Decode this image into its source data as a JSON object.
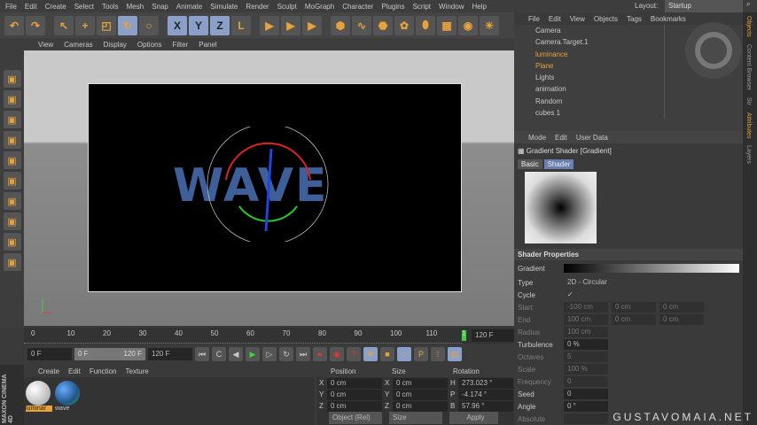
{
  "menu": [
    "File",
    "Edit",
    "Create",
    "Select",
    "Tools",
    "Mesh",
    "Snap",
    "Animate",
    "Simulate",
    "Render",
    "Sculpt",
    "MoGraph",
    "Character",
    "Plugins",
    "Script",
    "Window",
    "Help"
  ],
  "toolbar_icons": [
    "undo-icon",
    "redo-icon",
    "live-select-icon",
    "move-icon",
    "scale-icon",
    "rotate-icon",
    "recent-tool-icon",
    "x-axis-icon",
    "y-axis-icon",
    "z-axis-icon",
    "coordinate-system-icon",
    "render-view-icon",
    "render-picture-viewer-icon",
    "render-settings-icon",
    "cube-icon",
    "spline-icon",
    "nurbs-icon",
    "array-icon",
    "deformer-icon",
    "floor-icon",
    "camera-icon",
    "light-icon"
  ],
  "toolbar_labels": {
    "x": "X",
    "y": "Y",
    "z": "Z"
  },
  "viewport_menu": [
    "View",
    "Cameras",
    "Display",
    "Options",
    "Filter",
    "Panel"
  ],
  "viewport_text": "WAVE",
  "layout": {
    "label": "Layout:",
    "value": "Startup"
  },
  "object_manager": {
    "menu": [
      "File",
      "Edit",
      "View",
      "Objects",
      "Tags",
      "Bookmarks"
    ],
    "objects": [
      {
        "name": "Camera",
        "highlight": false
      },
      {
        "name": "Camera.Target.1",
        "highlight": false
      },
      {
        "name": "luminance",
        "highlight": true
      },
      {
        "name": "Plane",
        "highlight": true
      },
      {
        "name": "Lights",
        "highlight": false
      },
      {
        "name": "animation",
        "highlight": false
      },
      {
        "name": "Random",
        "highlight": false
      },
      {
        "name": "cubes 1",
        "highlight": false
      }
    ]
  },
  "attributes": {
    "menu": [
      "Mode",
      "Edit",
      "User Data"
    ],
    "title": "Gradient Shader [Gradient]",
    "tabs": [
      "Basic",
      "Shader"
    ],
    "active_tab": "Shader",
    "section": "Shader Properties",
    "gradient_label": "Gradient",
    "rows": [
      {
        "label": "Type",
        "value": "2D - Circular",
        "enabled": true
      },
      {
        "label": "Cycle",
        "value": "✓",
        "enabled": true
      },
      {
        "label": "Start",
        "value": "-100 cm",
        "v2": "0 cm",
        "v3": "0 cm",
        "enabled": false
      },
      {
        "label": "End",
        "value": "100 cm",
        "v2": "0 cm",
        "v3": "0 cm",
        "enabled": false
      },
      {
        "label": "Radius",
        "value": "100 cm",
        "enabled": false
      },
      {
        "label": "Turbulence",
        "value": "0 %",
        "enabled": true
      },
      {
        "label": "Octaves",
        "value": "5",
        "enabled": false
      },
      {
        "label": "Scale",
        "value": "100 %",
        "enabled": false
      },
      {
        "label": "Frequency",
        "value": "0",
        "enabled": false
      },
      {
        "label": "Seed",
        "value": "0",
        "enabled": true
      },
      {
        "label": "Angle",
        "value": "0 °",
        "enabled": true
      },
      {
        "label": "Absolute",
        "value": "",
        "enabled": false
      }
    ]
  },
  "side_tabs": [
    "Objects",
    "Content Browser",
    "Str",
    "Attributes",
    "Layers"
  ],
  "timeline": {
    "ticks": [
      "0",
      "10",
      "20",
      "30",
      "40",
      "50",
      "60",
      "70",
      "80",
      "90",
      "100",
      "110",
      "1"
    ],
    "end_field": "120 F",
    "current_frame": 120
  },
  "transport": {
    "start": "0 F",
    "range_start": "0 F",
    "range_end": "120 F",
    "end": "120 F"
  },
  "materials": {
    "menu": [
      "Create",
      "Edit",
      "Function",
      "Texture"
    ],
    "items": [
      {
        "name": "luminar",
        "selected": true
      },
      {
        "name": "wave",
        "selected": false
      }
    ]
  },
  "coordinates": {
    "headers": [
      "Position",
      "Size",
      "Rotation"
    ],
    "rows": [
      {
        "pl": "X",
        "p": "0 cm",
        "sl": "X",
        "s": "0 cm",
        "rl": "H",
        "r": "273.023 °"
      },
      {
        "pl": "Y",
        "p": "0 cm",
        "sl": "Y",
        "s": "0 cm",
        "rl": "P",
        "r": "-4.174 °"
      },
      {
        "pl": "Z",
        "p": "0 cm",
        "sl": "Z",
        "s": "0 cm",
        "rl": "B",
        "r": "57.96 °"
      }
    ],
    "mode": "Object (Rel)",
    "size_mode": "Size",
    "apply": "Apply"
  },
  "brand": "MAXON CINEMA 4D",
  "watermark": "GUSTAVOMAIA.NET",
  "colors": {
    "accent": "#e8a23a",
    "selected": "#8aa0c8",
    "play": "#3cd23c"
  }
}
